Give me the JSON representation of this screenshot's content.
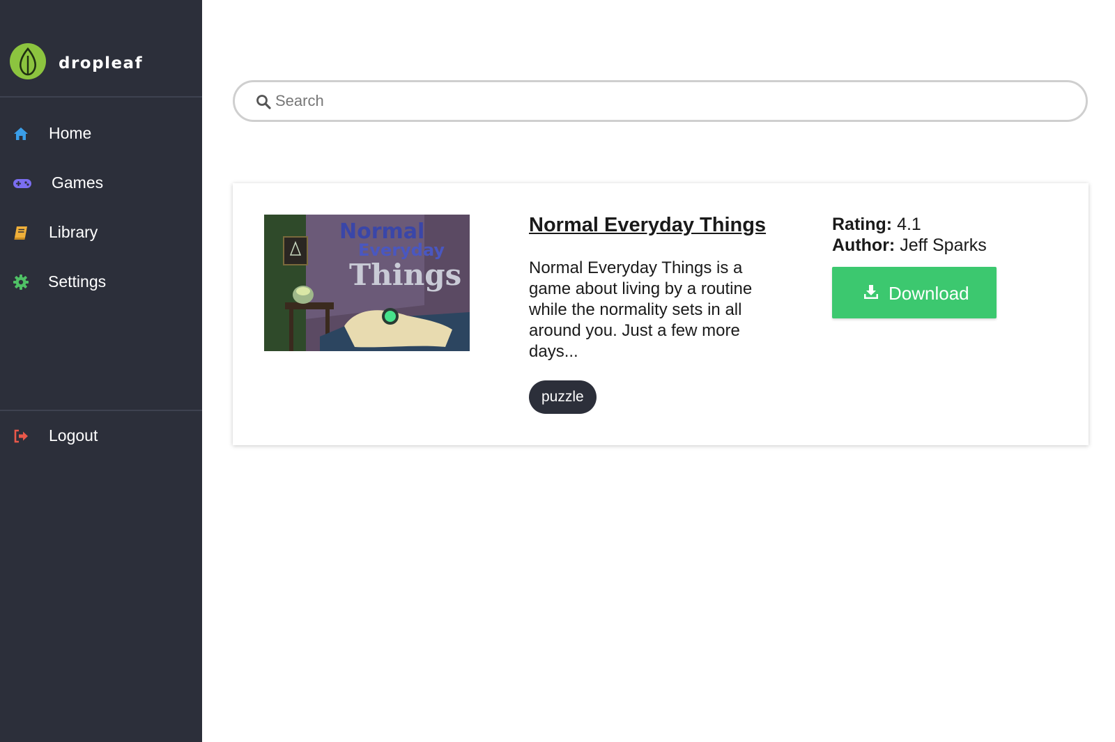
{
  "app": {
    "name": "dropleaf",
    "colors": {
      "sidebar_bg": "#2c2f3a",
      "brand_green": "#8cc43f",
      "download_green": "#3cc86f",
      "home_icon": "#3a9ee8",
      "games_icon": "#7b6ef0",
      "library_icon": "#f0b03a",
      "settings_icon": "#4fc065",
      "logout_icon": "#e9584a"
    }
  },
  "sidebar": {
    "items": [
      {
        "label": "Home",
        "icon": "home-icon"
      },
      {
        "label": "Games",
        "icon": "gamepad-icon"
      },
      {
        "label": "Library",
        "icon": "book-icon"
      },
      {
        "label": "Settings",
        "icon": "gear-icon"
      }
    ],
    "logout": {
      "label": "Logout",
      "icon": "sign-out-icon"
    }
  },
  "search": {
    "placeholder": "Search",
    "value": "",
    "icon": "search-icon"
  },
  "results": [
    {
      "title": "Normal Everyday Things",
      "description": "Normal Everyday Things is a game about living by a routine while the normality sets in all around you. Just a few more days...",
      "thumbnail_title_art": [
        "Normal",
        "Everyday",
        "Things"
      ],
      "tags": [
        "puzzle"
      ],
      "rating_label": "Rating:",
      "rating": "4.1",
      "author_label": "Author:",
      "author": "Jeff Sparks",
      "download_label": "Download",
      "download_icon": "download-icon"
    }
  ]
}
